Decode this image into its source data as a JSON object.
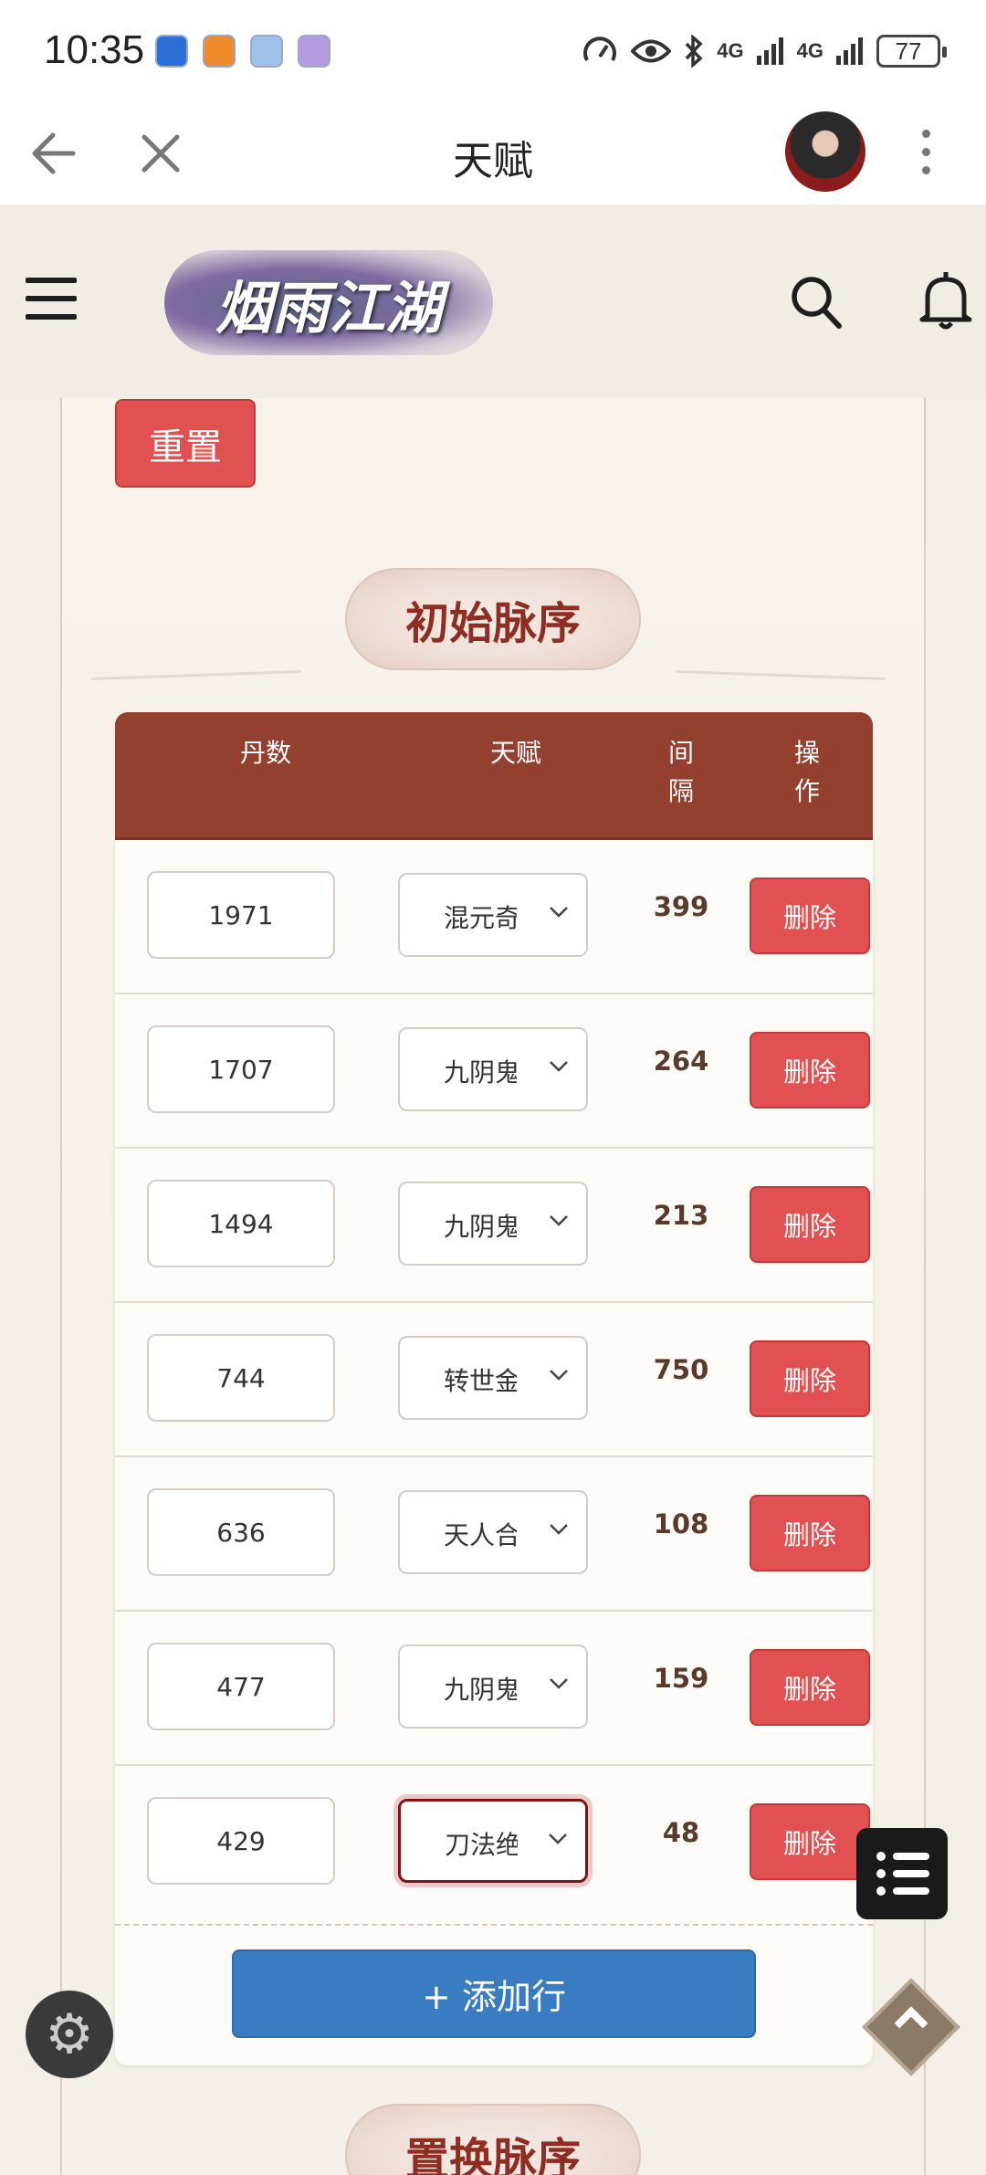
{
  "status_bar": {
    "time": "10:35",
    "network1": "4G",
    "network2": "4G",
    "battery": "77"
  },
  "topnav": {
    "title": "天赋"
  },
  "site": {
    "logo_text": "烟雨江湖"
  },
  "reset_label": "重置",
  "section1_title": "初始脉序",
  "section2_title": "置换脉序",
  "table": {
    "headers": {
      "dan": "丹数",
      "talent": "天赋",
      "interval": "间隔",
      "action": "操作"
    },
    "delete_label": "删除",
    "rows": [
      {
        "dan": "1971",
        "talent": "混元奇",
        "interval": "399"
      },
      {
        "dan": "1707",
        "talent": "九阴鬼",
        "interval": "264"
      },
      {
        "dan": "1494",
        "talent": "九阴鬼",
        "interval": "213"
      },
      {
        "dan": "744",
        "talent": "转世金",
        "interval": "750"
      },
      {
        "dan": "636",
        "talent": "天人合",
        "interval": "108"
      },
      {
        "dan": "477",
        "talent": "九阴鬼",
        "interval": "159"
      },
      {
        "dan": "429",
        "talent": "刀法绝",
        "interval": "48"
      }
    ],
    "add_row_label": "+ 添加行"
  },
  "colors": {
    "header_brown": "#93402f",
    "danger_red": "#e25151",
    "primary_blue": "#3a7cc2",
    "title_text": "#8e2d22"
  }
}
